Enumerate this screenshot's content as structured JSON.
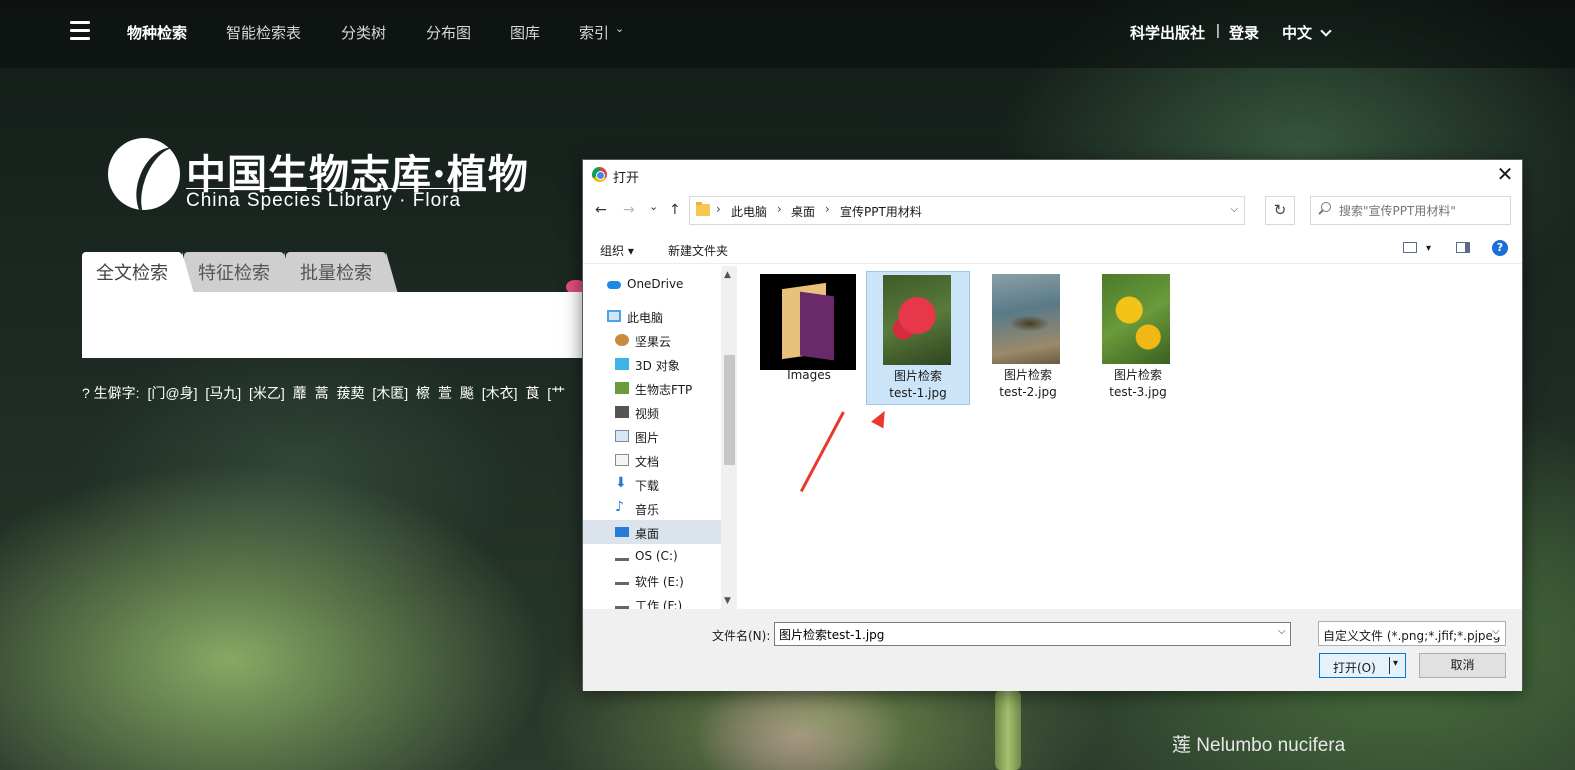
{
  "nav": {
    "items": [
      "物种检索",
      "智能检索表",
      "分类树",
      "分布图",
      "图库",
      "索引"
    ],
    "right": {
      "publisher": "科学出版社",
      "divider": "|",
      "login": "登录",
      "language": "中文"
    }
  },
  "logo": {
    "cn": "中国生物志库·植物",
    "en": "China Species Library ·  Flora"
  },
  "search": {
    "tabs": [
      "全文检索",
      "特征检索",
      "批量检索"
    ],
    "input_value": "",
    "rare_chars_label": "?  生僻字:",
    "rare_chars": [
      "[门@身]",
      "[马九]",
      "[米乙]",
      "蘼",
      "蒿",
      "菝葜",
      "[木匿]",
      "檫",
      "萱",
      "飈",
      "[木衣]",
      "莨",
      "[艹"
    ]
  },
  "caption": "莲 Nelumbo nucifera",
  "dialog": {
    "title": "打开",
    "close": "✕",
    "nav_buttons": {
      "back": "←",
      "forward": "→",
      "recent": "⌄",
      "up": "↑"
    },
    "breadcrumbs": [
      "此电脑",
      "桌面",
      "宣传PPT用材料"
    ],
    "crumb_sep": "›",
    "refresh": "↻",
    "search_placeholder": "搜索\"宣传PPT用材料\"",
    "toolbar": {
      "organize": "组织 ▾",
      "new_folder": "新建文件夹",
      "view_dd": "▾",
      "help": "?"
    },
    "nav_pane": [
      {
        "label": "OneDrive",
        "icon": "cloud-icon",
        "color": "#1e88e5"
      },
      {
        "label": "此电脑",
        "icon": "computer-icon",
        "color": "#4aa3e8"
      },
      {
        "label": "坚果云",
        "icon": "nut-icon",
        "color": "#c98a3a"
      },
      {
        "label": "3D 对象",
        "icon": "cube-icon",
        "color": "#3fb4e6"
      },
      {
        "label": "生物志FTP",
        "icon": "ftp-icon",
        "color": "#6a9a3c"
      },
      {
        "label": "视频",
        "icon": "film-icon",
        "color": "#555555"
      },
      {
        "label": "图片",
        "icon": "picture-icon",
        "color": "#6f8bb0"
      },
      {
        "label": "文档",
        "icon": "document-icon",
        "color": "#8a8a8a"
      },
      {
        "label": "下载",
        "icon": "download-icon",
        "color": "#2a7ad8"
      },
      {
        "label": "音乐",
        "icon": "music-icon",
        "color": "#2a7ad8"
      },
      {
        "label": "桌面",
        "icon": "desktop-icon",
        "color": "#2a7ad8"
      },
      {
        "label": "OS (C:)",
        "icon": "drive-icon",
        "color": "#666666"
      },
      {
        "label": "软件 (E:)",
        "icon": "drive-icon",
        "color": "#666666"
      },
      {
        "label": "工作 (F:)",
        "icon": "drive-icon",
        "color": "#666666"
      }
    ],
    "selected_nav": "桌面",
    "scroll_up": "▲",
    "scroll_down": "▼",
    "files": [
      {
        "name_l1": "Images",
        "name_l2": "",
        "kind": "folder"
      },
      {
        "name_l1": "图片检索",
        "name_l2": "test-1.jpg",
        "kind": "red-flowers"
      },
      {
        "name_l1": "图片检索",
        "name_l2": "test-2.jpg",
        "kind": "pond"
      },
      {
        "name_l1": "图片检索",
        "name_l2": "test-3.jpg",
        "kind": "yellow-flowers"
      }
    ],
    "selected_file": "test-1.jpg",
    "file_name_label": "文件名(N):",
    "file_name_value": "图片检索test-1.jpg",
    "file_type": "自定义文件 (*.png;*.jfif;*.pjpeg",
    "dropdown_glyph": "⌵",
    "open_label": "打开(O)",
    "open_dd": "▾",
    "cancel_label": "取消"
  }
}
